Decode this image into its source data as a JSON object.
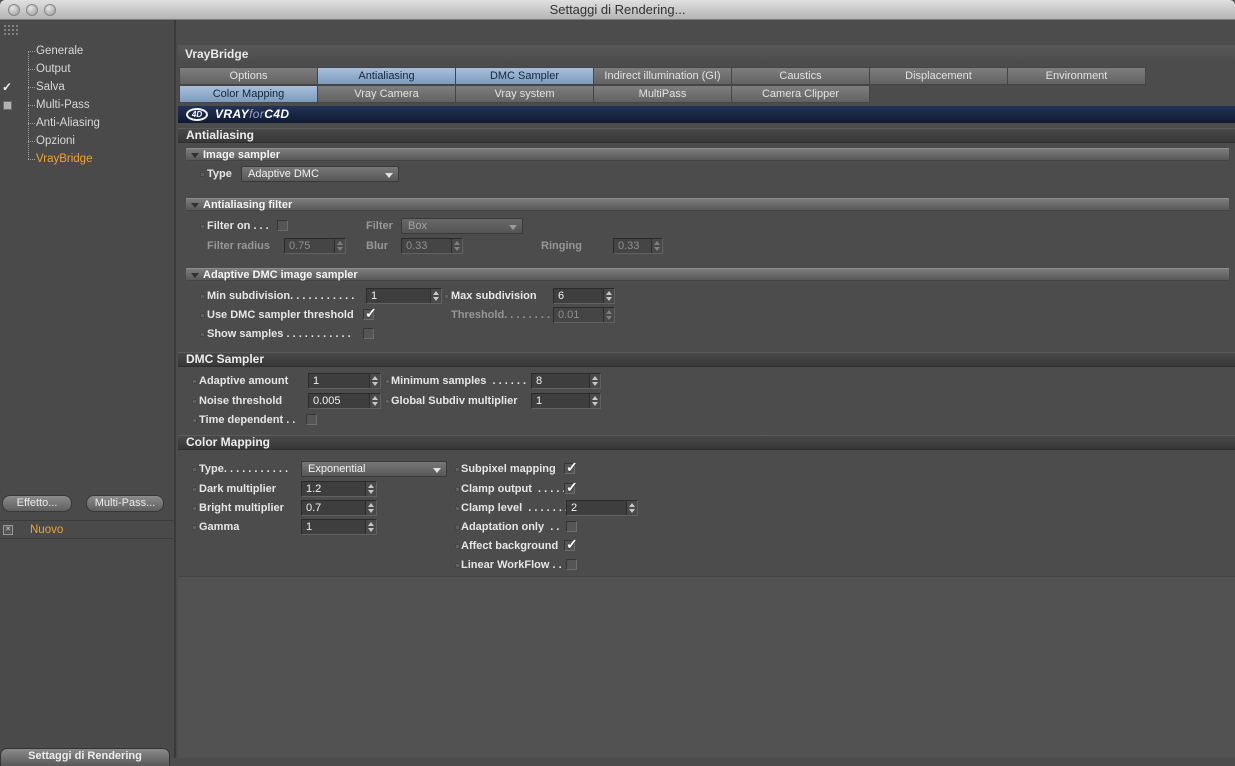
{
  "window": {
    "title": "Settaggi di Rendering..."
  },
  "sidebar": {
    "items": [
      {
        "label": "Generale"
      },
      {
        "label": "Output"
      },
      {
        "label": "Salva",
        "checked": true
      },
      {
        "label": "Multi-Pass",
        "checkbox": true
      },
      {
        "label": "Anti-Aliasing"
      },
      {
        "label": "Opzioni"
      },
      {
        "label": "VrayBridge",
        "selected": true
      }
    ],
    "buttons": {
      "effect": "Effetto...",
      "multipass": "Multi-Pass..."
    },
    "nuovo": "Nuovo",
    "bottom_tab": "Settaggi di Rendering"
  },
  "panel": {
    "title": "VrayBridge",
    "tabs_row1": [
      {
        "label": "Options",
        "active": false
      },
      {
        "label": "Antialiasing",
        "active": true
      },
      {
        "label": "DMC Sampler",
        "active": true
      },
      {
        "label": "Indirect illumination (GI)",
        "active": false
      },
      {
        "label": "Caustics",
        "active": false
      },
      {
        "label": "Displacement",
        "active": false
      },
      {
        "label": "Environment",
        "active": false
      }
    ],
    "tabs_row2": [
      {
        "label": "Color Mapping",
        "active": true
      },
      {
        "label": "Vray Camera",
        "active": false
      },
      {
        "label": "Vray system",
        "active": false
      },
      {
        "label": "MultiPass",
        "active": false
      },
      {
        "label": "Camera Clipper",
        "active": false
      }
    ],
    "logo": {
      "badge": "4D",
      "vray": "VRAY",
      "for": "for",
      "c4d": "C4D"
    }
  },
  "antialiasing": {
    "section_title": "Antialiasing",
    "image_sampler": {
      "header": "Image sampler",
      "type_label": "Type",
      "type_value": "Adaptive DMC"
    },
    "filter": {
      "header": "Antialiasing filter",
      "filter_on_label": "Filter on . . .",
      "filter_on_checked": false,
      "filter_label": "Filter",
      "filter_value": "Box",
      "radius_label": "Filter radius",
      "radius_value": "0.75",
      "blur_label": "Blur",
      "blur_value": "0.33",
      "ringing_label": "Ringing",
      "ringing_value": "0.33"
    },
    "adaptive": {
      "header": "Adaptive DMC image sampler",
      "min_label": "Min subdivision. . . . . . . . . . .",
      "min_value": "1",
      "max_label": "Max subdivision",
      "max_value": "6",
      "use_thresh_label": "Use DMC sampler threshold",
      "use_thresh_checked": true,
      "thresh_label": "Threshold. . . . . . . .",
      "thresh_value": "0.01",
      "show_samples_label": "Show samples . . . . . . . . . . .",
      "show_samples_checked": false
    }
  },
  "dmc": {
    "section_title": "DMC Sampler",
    "adaptive_amount_label": "Adaptive amount",
    "adaptive_amount_value": "1",
    "minimum_samples_label": "Minimum samples  . . . . . .",
    "minimum_samples_value": "8",
    "noise_label": "Noise threshold",
    "noise_value": "0.005",
    "global_label": "Global Subdiv multiplier",
    "global_value": "1",
    "time_label": "Time dependent . .",
    "time_checked": false
  },
  "colormap": {
    "section_title": "Color Mapping",
    "type_label": "Type. . . . . . . . . . .",
    "type_value": "Exponential",
    "dark_label": "Dark multiplier",
    "dark_value": "1.2",
    "bright_label": "Bright multiplier",
    "bright_value": "0.7",
    "gamma_label": "Gamma",
    "gamma_value": "1",
    "subpixel_label": "Subpixel mapping",
    "subpixel_checked": true,
    "clamp_out_label": "Clamp output  . . . . .",
    "clamp_out_checked": true,
    "clamp_level_label": "Clamp level  . . . . . . .",
    "clamp_level_value": "2",
    "adaptation_label": "Adaptation only  . .",
    "adaptation_checked": false,
    "affect_label": "Affect background",
    "affect_checked": true,
    "linear_label": "Linear WorkFlow . .",
    "linear_checked": false
  },
  "colors": {
    "accent_orange": "#f0a232",
    "tab_active": "#8faecd",
    "logo_bar": "#18253f"
  }
}
